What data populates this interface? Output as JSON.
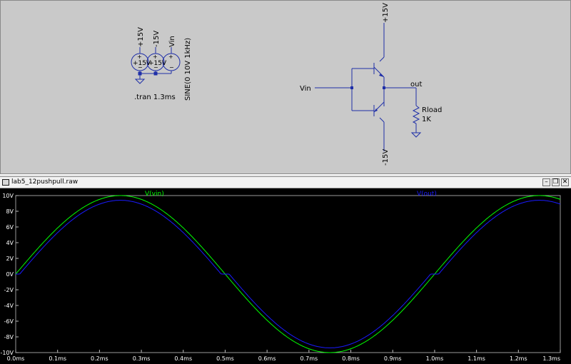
{
  "schematic": {
    "sources": [
      {
        "net_label": "+15V",
        "value_label": "+15V"
      },
      {
        "net_label": "-15V",
        "value_label": "+15V"
      },
      {
        "net_label": "Vin",
        "value_label": ""
      }
    ],
    "spice_directive": ".tran 1.3ms",
    "vin_source_spec": "SINE(0 10V 1kHz)",
    "input_label": "Vin",
    "output_label": "out",
    "top_rail": "+15V",
    "bottom_rail": "-15V",
    "resistor_name": "Rload",
    "resistor_value": "1K"
  },
  "waveform_window": {
    "title": "lab5_12pushpull.raw",
    "legend_vin": "V(vin)",
    "legend_out": "V(out)"
  },
  "colors": {
    "schematic_bg": "#c9c9c9",
    "wire": "#1f2fa8",
    "plot_bg": "#000000",
    "vin_trace": "#00ff00",
    "out_trace": "#1a1aff",
    "axis_text": "#ffffff",
    "grid": "#4a4a4a"
  },
  "chart_data": {
    "type": "line",
    "x_unit": "ms",
    "y_unit": "V",
    "xlim": [
      0.0,
      1.3
    ],
    "ylim": [
      -10,
      10
    ],
    "x_ticks": [
      "0.0ms",
      "0.1ms",
      "0.2ms",
      "0.3ms",
      "0.4ms",
      "0.5ms",
      "0.6ms",
      "0.7ms",
      "0.8ms",
      "0.9ms",
      "1.0ms",
      "1.1ms",
      "1.2ms",
      "1.3ms"
    ],
    "y_ticks": [
      "10V",
      "8V",
      "6V",
      "4V",
      "2V",
      "0V",
      "-2V",
      "-4V",
      "-6V",
      "-8V",
      "-10V"
    ],
    "grid": true,
    "series": [
      {
        "name": "V(vin)",
        "kind": "sine",
        "amplitude": 10,
        "frequency_khz": 1,
        "offset": 0,
        "color": "#00ff00"
      },
      {
        "name": "V(out)",
        "kind": "sine_crossover",
        "amplitude": 10,
        "frequency_khz": 1,
        "dead_zone": 0.6,
        "color": "#1a1aff"
      }
    ]
  }
}
